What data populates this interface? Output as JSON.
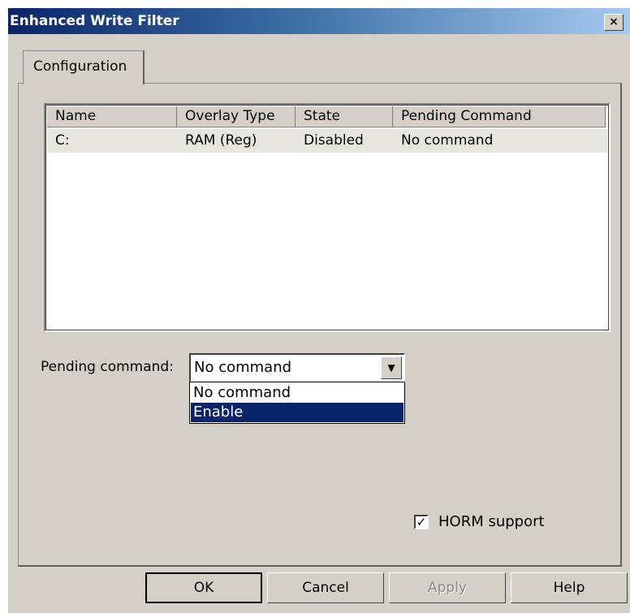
{
  "window": {
    "title": "Enhanced Write Filter",
    "close_label": "×"
  },
  "tabs": [
    {
      "label": "Configuration"
    }
  ],
  "table": {
    "columns": [
      "Name",
      "Overlay Type",
      "State",
      "Pending Command"
    ],
    "rows": [
      [
        "C:",
        "RAM (Reg)",
        "Disabled",
        "No command"
      ]
    ]
  },
  "pending": {
    "label": "Pending command:",
    "value": "No command",
    "options": [
      "No command",
      "Enable"
    ],
    "highlighted": "Enable"
  },
  "horm": {
    "label": "HORM support",
    "checked": true,
    "check_glyph": "✓"
  },
  "buttons": {
    "ok": "OK",
    "cancel": "Cancel",
    "apply": "Apply",
    "help": "Help"
  },
  "colors": {
    "title_start": "#0a246a",
    "title_end": "#a6caf0",
    "selection": "#0a246a",
    "face": "#d4d0c8"
  }
}
